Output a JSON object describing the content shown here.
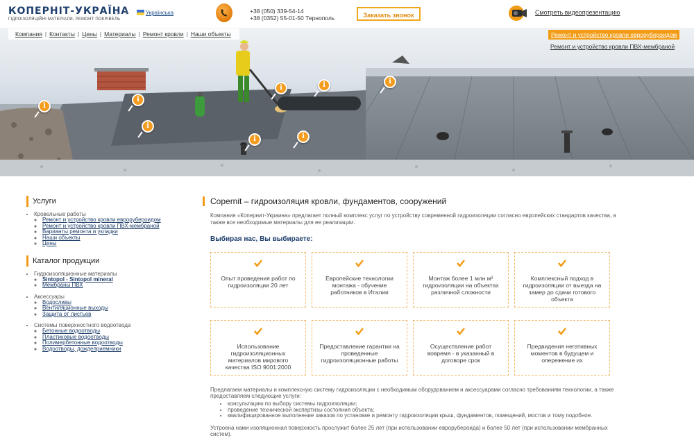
{
  "header": {
    "logo_text": "КОПЕРНІТ-УКРАЇНА",
    "logo_tagline": "ГІДРОІЗОЛЯЦІЙНІ МАТЕРІАЛИ, РЕМОНТ ПОКРІВЕЛЬ",
    "language_label": "Українська",
    "phone_1": "+38 (050) 339-54-14",
    "phone_2": "+38 (0352) 55-01-50 Тернополь",
    "callback_button": "Заказать звонок",
    "video_link": "Смотреть видеопрезентацию"
  },
  "nav": {
    "items": [
      "Компания",
      "Контакты",
      "Цены",
      "Материалы",
      "Ремонт кровли",
      "Наши объекты"
    ]
  },
  "promo": {
    "active_link": "Ремонт и устройство кровли еврорубероидом",
    "secondary_link": "Ремонт и устройство кровли ПВХ-мембраной"
  },
  "sidebar": {
    "services_title": "Услуги",
    "services": {
      "group_title": "Кровельные работы",
      "items": [
        "Ремонт и устройство кровли еврорубероидом",
        "Ремонт и устройство кровли ПВХ-мембраной"
      ],
      "extra_items": [
        "Варианты ремонта и укладки",
        "Наши объекты",
        "Цены"
      ]
    },
    "catalog_title": "Каталог продукции",
    "catalog": [
      {
        "title": "Гидроизоляционные материалы",
        "items": [
          "Sintopol - Sintopol mineral",
          "Мембраны ПВХ"
        ]
      },
      {
        "title": "Аксессуары",
        "items": [
          "Водосливы",
          "Вентиляционные выходы",
          "Защита от листьев"
        ]
      },
      {
        "title": "Системы поверхностного водоотвода",
        "items": [
          "Бетонные водоотводы",
          "Пластиковые водоотводы",
          "Полимербетонные водоотводы",
          "Водоотводы, дождеприемники"
        ]
      }
    ]
  },
  "main": {
    "title": "Copernit – гидроизоляция кровли, фундаментов, сооружений",
    "intro": "Компания «Копернит-Украина» предлагает полный комплекс услуг по устройству современной гидроизоляции согласно европейских стандартов качества, а также все необходимые материалы для ее реализации.",
    "choose_heading": "Выбирая нас, Вы выбираете:",
    "cards": [
      "Опыт проведения работ по гидроизоляции 20 лет",
      "Европейские технологии монтажа - обучение работников в Италии",
      "Монтаж более 1 млн м² гидроизоляции на объектах различной сложности",
      "Комплексный подход в гидроизоляции от выезда на замер до сдачи готового объекта",
      "Использование гидроизоляционных материалов мирового качества ISO 9001:2000",
      "Предоставление гарантии на проведенные гидроизоляционные работы",
      "Осуществление работ вовремя - в указанный в договоре срок",
      "Предвидения негативных моментов в будущем и опережение их"
    ],
    "outro": "Предлагаем материалы и комплексную систему гидроизоляции с необходимым оборудованием и аксессуарами согласно требованиям технологии, а также предоставляем следующие услуги:",
    "services_list": [
      "консультацию по выбору системы гидроизоляции;",
      "проведение технической экспертизы состояния объекта;",
      "квалифицированное выполнение заказов по установке и ремонту гидроизоляции крыш, фундаментов, помещений, мостов и тому подобное."
    ],
    "footer_text": "Устроена нами изоляционная поверхность прослужит более 25 лет (при использовании еврорубероида) и более 50 лет (при использовании мембранных систем)."
  },
  "colors": {
    "accent": "#f29b14",
    "brand": "#1e3f6d",
    "card_border": "#f0b868"
  }
}
